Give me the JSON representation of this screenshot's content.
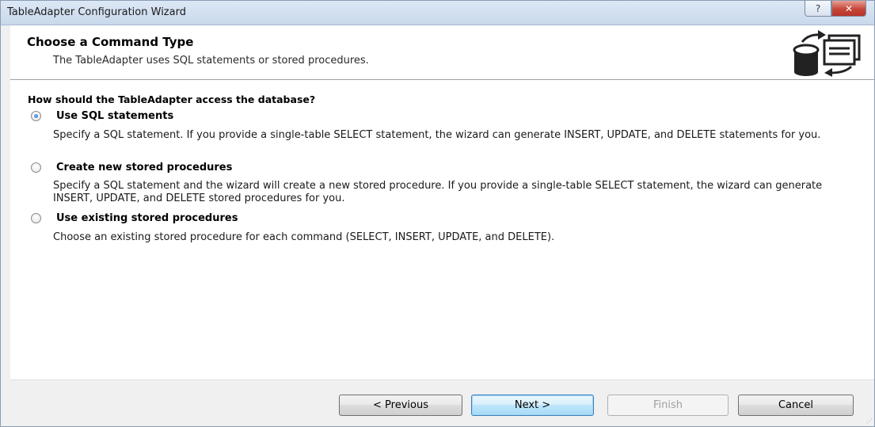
{
  "window": {
    "title": "TableAdapter Configuration Wizard",
    "help_glyph": "?",
    "close_glyph": "✕"
  },
  "header": {
    "title": "Choose a Command Type",
    "subtitle": "The TableAdapter uses SQL statements or stored procedures.",
    "icon": "database-exchange-icon"
  },
  "body": {
    "question": "How should the TableAdapter access the database?",
    "options": [
      {
        "label": "Use SQL statements",
        "selected": true,
        "description": "Specify a SQL statement. If you provide a single-table SELECT statement, the wizard can generate INSERT, UPDATE, and DELETE statements for you."
      },
      {
        "label": "Create new stored procedures",
        "selected": false,
        "description": "Specify a SQL statement and the wizard will create a new stored procedure. If you provide a single-table SELECT statement, the wizard can generate INSERT, UPDATE, and DELETE stored procedures for you."
      },
      {
        "label": "Use existing stored procedures",
        "selected": false,
        "description": "Choose an existing stored procedure for each command (SELECT, INSERT, UPDATE, and DELETE)."
      }
    ]
  },
  "footer": {
    "previous_label": "< Previous",
    "next_label": "Next >",
    "finish_label": "Finish",
    "cancel_label": "Cancel",
    "finish_enabled": false
  },
  "colors": {
    "titlebar": "#c9d8ec",
    "close_button": "#c7463a",
    "default_button_border": "#3c7fb1",
    "footer_bg": "#f0f0f0"
  }
}
